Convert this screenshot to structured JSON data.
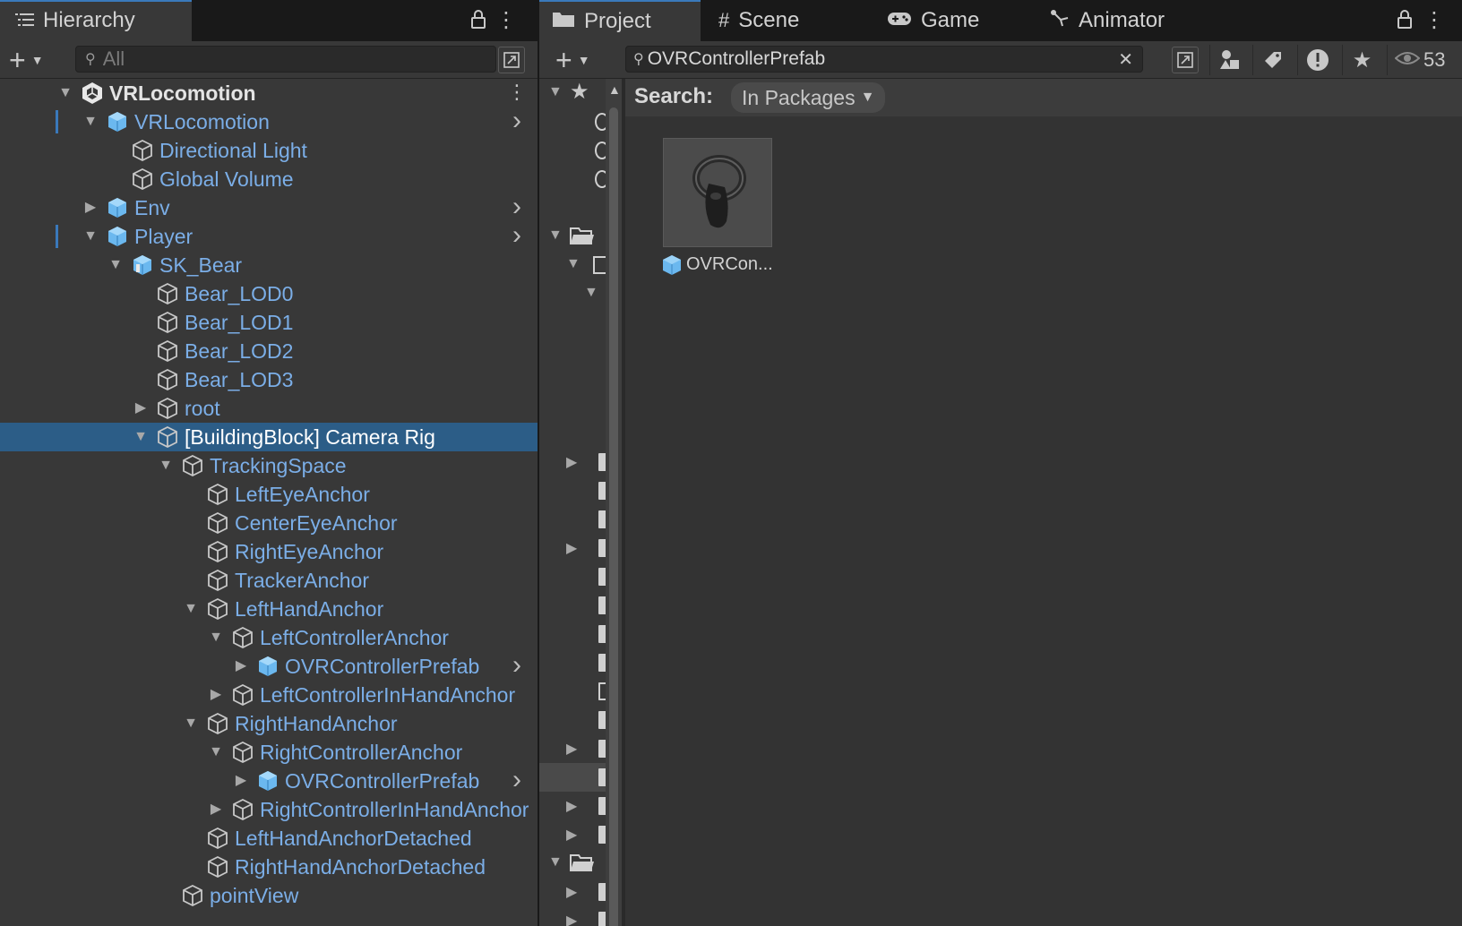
{
  "hierarchy": {
    "tab_label": "Hierarchy",
    "search_placeholder": "All",
    "rows": [
      {
        "name": "VRLocomotion",
        "depth": 0,
        "arrow": "down",
        "icon": "unity-scene-icon",
        "root": true,
        "dots": true
      },
      {
        "name": "VRLocomotion",
        "depth": 1,
        "arrow": "down",
        "icon": "prefab-icon",
        "chevron": true,
        "mark": true
      },
      {
        "name": "Directional Light",
        "depth": 2,
        "arrow": "",
        "icon": "gameobject-icon"
      },
      {
        "name": "Global Volume",
        "depth": 2,
        "arrow": "",
        "icon": "gameobject-icon"
      },
      {
        "name": "Env",
        "depth": 1,
        "arrow": "right",
        "icon": "prefab-icon",
        "chevron": true
      },
      {
        "name": "Player",
        "depth": 1,
        "arrow": "down",
        "icon": "prefab-icon",
        "chevron": true,
        "mark": true
      },
      {
        "name": "SK_Bear",
        "depth": 2,
        "arrow": "down",
        "icon": "model-prefab-icon"
      },
      {
        "name": "Bear_LOD0",
        "depth": 3,
        "arrow": "",
        "icon": "gameobject-icon"
      },
      {
        "name": "Bear_LOD1",
        "depth": 3,
        "arrow": "",
        "icon": "gameobject-icon"
      },
      {
        "name": "Bear_LOD2",
        "depth": 3,
        "arrow": "",
        "icon": "gameobject-icon"
      },
      {
        "name": "Bear_LOD3",
        "depth": 3,
        "arrow": "",
        "icon": "gameobject-icon"
      },
      {
        "name": "root",
        "depth": 3,
        "arrow": "right",
        "icon": "gameobject-icon"
      },
      {
        "name": "[BuildingBlock] Camera Rig",
        "depth": 3,
        "arrow": "down",
        "icon": "gameobject-icon",
        "selected": true
      },
      {
        "name": "TrackingSpace",
        "depth": 4,
        "arrow": "down",
        "icon": "gameobject-icon"
      },
      {
        "name": "LeftEyeAnchor",
        "depth": 5,
        "arrow": "",
        "icon": "gameobject-icon"
      },
      {
        "name": "CenterEyeAnchor",
        "depth": 5,
        "arrow": "",
        "icon": "gameobject-icon"
      },
      {
        "name": "RightEyeAnchor",
        "depth": 5,
        "arrow": "",
        "icon": "gameobject-icon"
      },
      {
        "name": "TrackerAnchor",
        "depth": 5,
        "arrow": "",
        "icon": "gameobject-icon"
      },
      {
        "name": "LeftHandAnchor",
        "depth": 5,
        "arrow": "down",
        "icon": "gameobject-icon"
      },
      {
        "name": "LeftControllerAnchor",
        "depth": 6,
        "arrow": "down",
        "icon": "gameobject-icon"
      },
      {
        "name": "OVRControllerPrefab",
        "depth": 7,
        "arrow": "right",
        "icon": "prefab-icon",
        "chevron": true
      },
      {
        "name": "LeftControllerInHandAnchor",
        "depth": 6,
        "arrow": "right",
        "icon": "gameobject-icon"
      },
      {
        "name": "RightHandAnchor",
        "depth": 5,
        "arrow": "down",
        "icon": "gameobject-icon"
      },
      {
        "name": "RightControllerAnchor",
        "depth": 6,
        "arrow": "down",
        "icon": "gameobject-icon"
      },
      {
        "name": "OVRControllerPrefab",
        "depth": 7,
        "arrow": "right",
        "icon": "prefab-icon",
        "chevron": true
      },
      {
        "name": "RightControllerInHandAnchor",
        "depth": 6,
        "arrow": "right",
        "icon": "gameobject-icon"
      },
      {
        "name": "LeftHandAnchorDetached",
        "depth": 5,
        "arrow": "",
        "icon": "gameobject-icon"
      },
      {
        "name": "RightHandAnchorDetached",
        "depth": 5,
        "arrow": "",
        "icon": "gameobject-icon"
      },
      {
        "name": "pointView",
        "depth": 4,
        "arrow": "",
        "icon": "gameobject-icon"
      }
    ]
  },
  "project": {
    "tabs": [
      {
        "label": "Project",
        "icon": "folder-icon",
        "active": true
      },
      {
        "label": "Scene",
        "icon": "grid-icon"
      },
      {
        "label": "Game",
        "icon": "gamepad-icon"
      },
      {
        "label": "Animator",
        "icon": "animator-icon"
      }
    ],
    "search_value": "OVRControllerPrefab",
    "visibility_count": "53",
    "search_label": "Search:",
    "search_scope": "In Packages",
    "asset_name": "OVRCon..."
  },
  "colors": {
    "panel_bg": "#383838",
    "selection": "#2c5d87",
    "prefab_text": "#7baee7",
    "accent": "#3a79bb"
  }
}
